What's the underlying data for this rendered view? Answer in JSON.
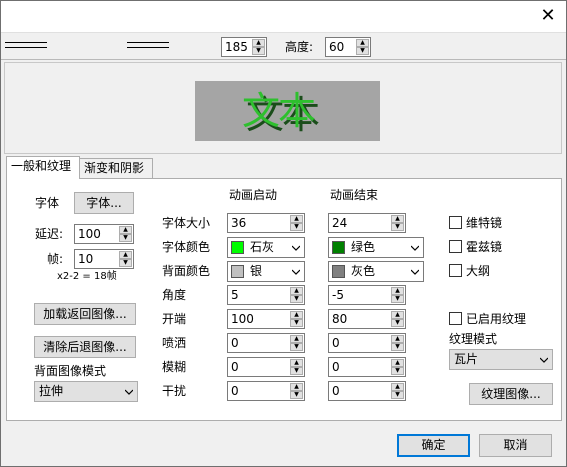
{
  "window": {
    "close_glyph": "✕"
  },
  "toolbar": {
    "width_value": "185",
    "height_label": "高度:",
    "height_value": "60"
  },
  "preview": {
    "text": "文本",
    "text_color": "#2ec02e",
    "shadow_color": "#1a4d1a",
    "background": "#a5a5a5"
  },
  "tabs": [
    {
      "label": "一般和纹理",
      "active": true
    },
    {
      "label": "渐变和阴影",
      "active": false
    }
  ],
  "general": {
    "font_label": "字体",
    "font_button": "字体...",
    "delay_label": "延迟:",
    "delay_value": "100",
    "frames_label": "帧:",
    "frames_value": "10",
    "size_info": "x2-2 = 18帧",
    "load_back_button": "加载返回图像...",
    "clear_back_button": "清除后退图像...",
    "bg_mode_label": "背面图像模式",
    "bg_mode_value": "拉伸"
  },
  "anim": {
    "start_header": "动画启动",
    "end_header": "动画结束",
    "rows": {
      "font_size": {
        "label": "字体大小",
        "start": "36",
        "end": "24"
      },
      "font_color": {
        "label": "字体颜色",
        "start": "石灰",
        "start_color": "#00ff00",
        "end": "绿色",
        "end_color": "#008000"
      },
      "bg_color": {
        "label": "背面颜色",
        "start": "银",
        "start_color": "#c0c0c0",
        "end": "灰色",
        "end_color": "#808080"
      },
      "angle": {
        "label": "角度",
        "start": "5",
        "end": "-5"
      },
      "opening": {
        "label": "开端",
        "start": "100",
        "end": "80"
      },
      "spray": {
        "label": "喷洒",
        "start": "0",
        "end": "0"
      },
      "blur": {
        "label": "模糊",
        "start": "0",
        "end": "0"
      },
      "interference": {
        "label": "干扰",
        "start": "0",
        "end": "0"
      }
    }
  },
  "effects": {
    "mirror_label": "维特镜",
    "hough_label": "霍兹镜",
    "outline_label": "大纲",
    "texture_enabled_label": "已启用纹理",
    "texture_mode_label": "纹理模式",
    "texture_mode_value": "瓦片",
    "texture_image_button": "纹理图像..."
  },
  "footer": {
    "ok_button": "确定",
    "cancel_button": "取消"
  }
}
